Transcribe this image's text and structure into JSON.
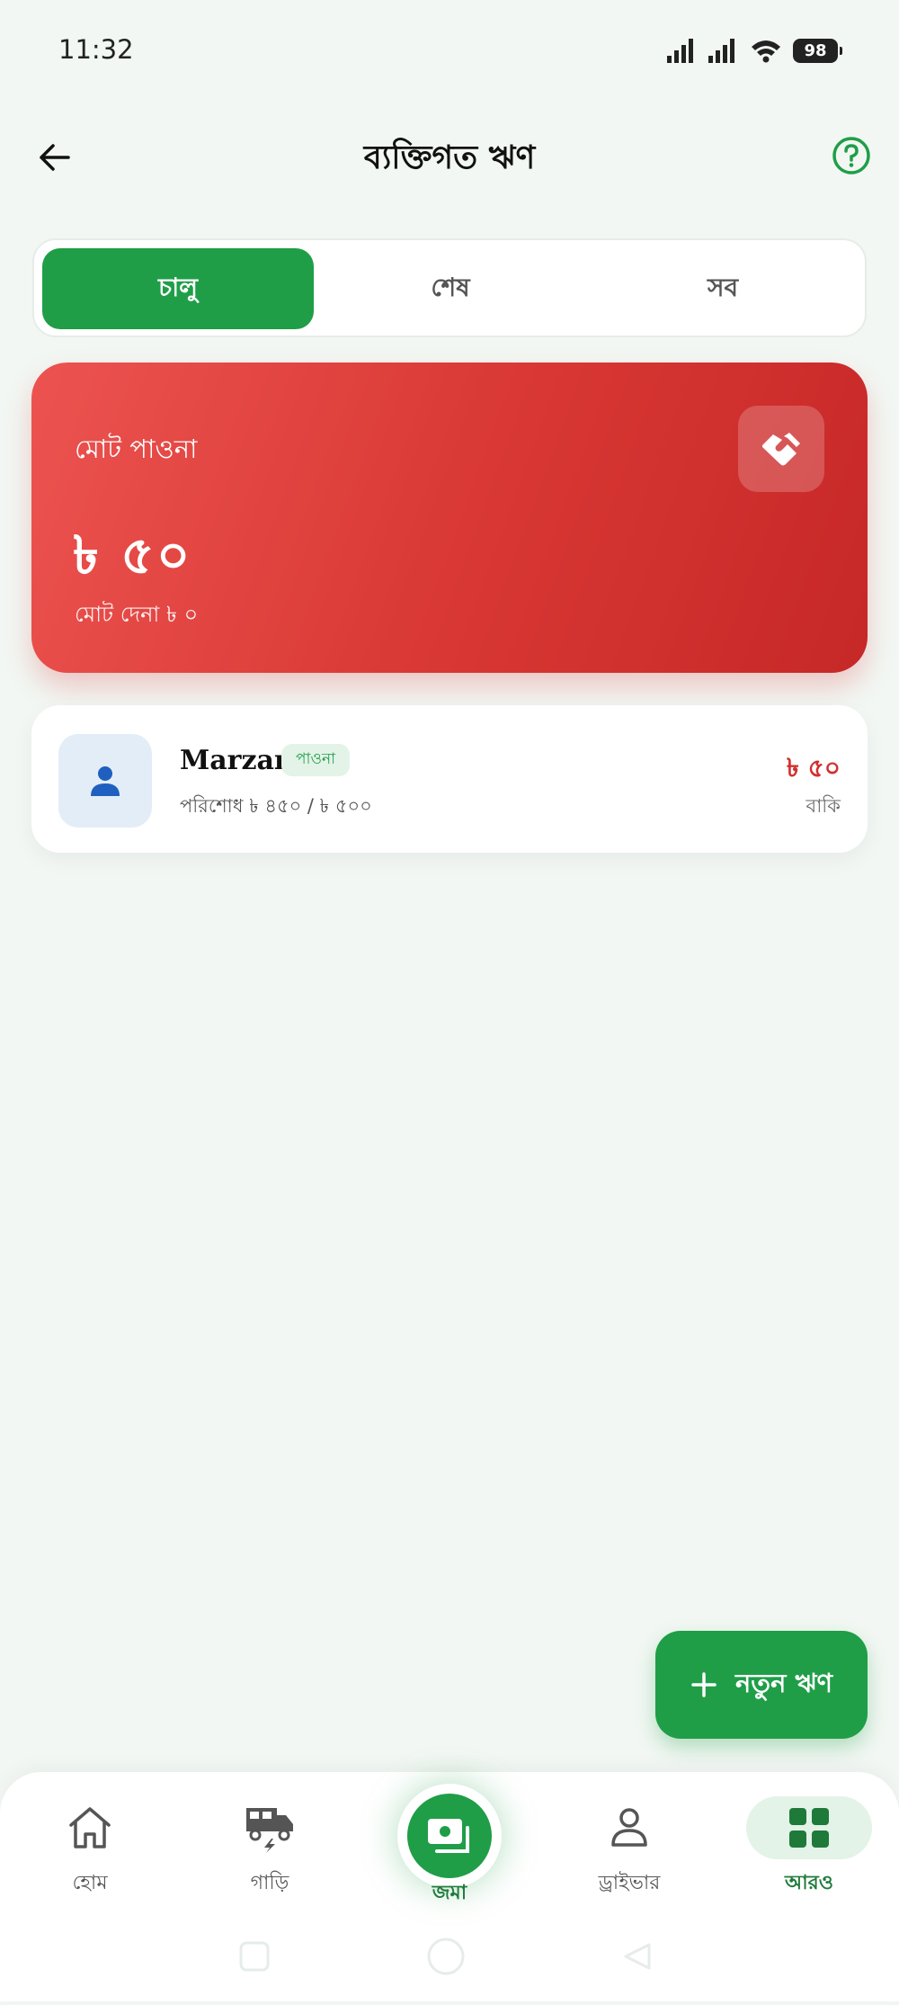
{
  "status_bar": {
    "time": "11:32",
    "battery": "98",
    "icons": [
      "signal-icon",
      "signal-icon",
      "wifi-icon",
      "battery-icon"
    ]
  },
  "header": {
    "title": "ব্যক্তিগত ঋণ",
    "back_icon": "arrow-left-icon",
    "help_icon": "help-circle-icon"
  },
  "tabs": [
    {
      "label": "চালু",
      "active": true
    },
    {
      "label": "শেষ",
      "active": false
    },
    {
      "label": "সব",
      "active": false
    }
  ],
  "summary": {
    "label": "মোট পাওনা",
    "amount": "৳ ৫০",
    "sub": "মোট দেনা ৳ ০",
    "icon": "handshake-icon"
  },
  "loans": [
    {
      "name": "Marzan",
      "badge": "পাওনা",
      "progress": "পরিশোধ ৳ ৪৫০ / ৳ ৫০০",
      "due": "৳ ৫০",
      "due_label": "বাকি",
      "icon": "person-icon"
    }
  ],
  "fab": {
    "label": "নতুন ঋণ",
    "icon": "plus-icon"
  },
  "bottom_nav": [
    {
      "label": "হোম",
      "icon": "home-icon"
    },
    {
      "label": "গাড়ি",
      "icon": "vehicle-icon"
    },
    {
      "label": "জমা",
      "icon": "deposit-icon",
      "active": true
    },
    {
      "label": "ড্রাইভার",
      "icon": "driver-icon"
    },
    {
      "label": "আরও",
      "icon": "grid-icon",
      "active": true
    }
  ],
  "colors": {
    "primary": "#1f9e47",
    "danger": "#d32f2f",
    "background": "#f2f7f3"
  }
}
